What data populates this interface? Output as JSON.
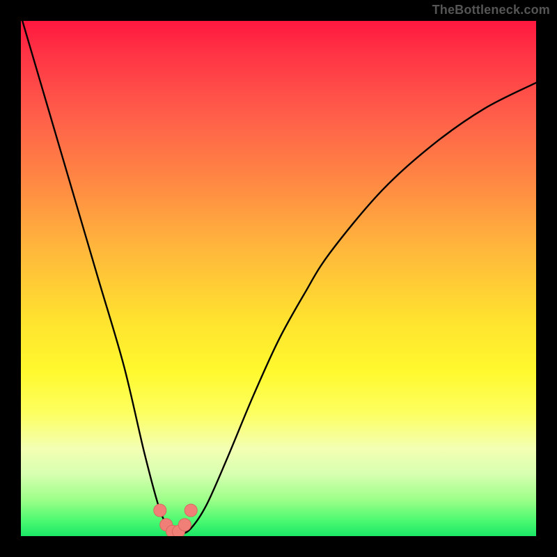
{
  "watermark": "TheBottleneck.com",
  "colors": {
    "frame": "#000000",
    "curve_stroke": "#000000",
    "marker_fill": "#f08077",
    "marker_stroke": "#d8685f",
    "watermark": "#555555"
  },
  "chart_data": {
    "type": "line",
    "title": "",
    "xlabel": "",
    "ylabel": "",
    "xlim": [
      0,
      100
    ],
    "ylim": [
      0,
      100
    ],
    "grid": false,
    "legend": false,
    "series": [
      {
        "name": "bottleneck-curve",
        "x": [
          0,
          5,
          10,
          15,
          20,
          24,
          27,
          29,
          31,
          33,
          36,
          40,
          45,
          50,
          55,
          60,
          70,
          80,
          90,
          100
        ],
        "y": [
          101,
          84,
          67,
          50,
          33,
          16,
          5,
          1.5,
          0.5,
          1.5,
          6,
          15,
          27,
          38,
          47,
          55,
          67,
          76,
          83,
          88
        ]
      }
    ],
    "markers": {
      "name": "valley-markers",
      "x": [
        27.0,
        28.2,
        29.4,
        30.6,
        31.8,
        33.0
      ],
      "y": [
        5.0,
        2.2,
        0.9,
        0.9,
        2.2,
        5.0
      ]
    }
  }
}
